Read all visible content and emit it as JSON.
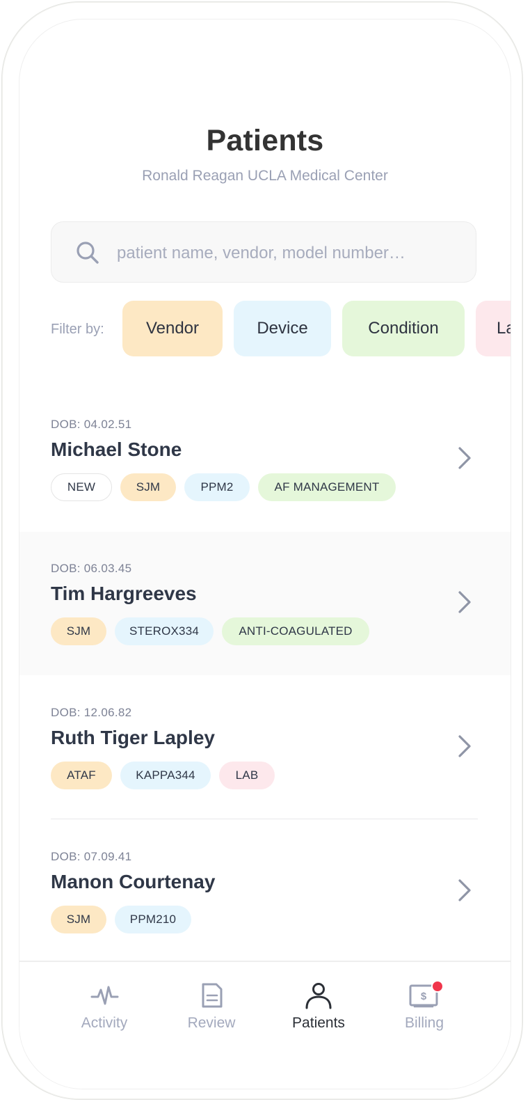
{
  "header": {
    "title": "Patients",
    "subtitle": "Ronald Reagan UCLA Medical Center"
  },
  "search": {
    "placeholder": "patient name, vendor, model number…",
    "value": "",
    "icon": "search-icon"
  },
  "filters": {
    "label": "Filter by:",
    "chips": [
      {
        "label": "Vendor",
        "color": "#fde8c4"
      },
      {
        "label": "Device",
        "color": "#e5f5fd"
      },
      {
        "label": "Condition",
        "color": "#e5f7da"
      },
      {
        "label": "La",
        "color": "#fde8ec"
      }
    ]
  },
  "colors": {
    "vendor": "#fde8c4",
    "device": "#e5f5fd",
    "condition": "#e5f7da",
    "lab": "#fde8ec",
    "new_border": "#e4e4e4",
    "badge": "#f0354b"
  },
  "patients": [
    {
      "dob": "DOB: 04.02.51",
      "name": "Michael Stone",
      "tags": [
        {
          "label": "NEW",
          "kind": "new"
        },
        {
          "label": "SJM",
          "kind": "vendor"
        },
        {
          "label": "PPM2",
          "kind": "device"
        },
        {
          "label": "AF MANAGEMENT",
          "kind": "condition"
        }
      ]
    },
    {
      "dob": "DOB: 06.03.45",
      "name": "Tim Hargreeves",
      "tags": [
        {
          "label": "SJM",
          "kind": "vendor"
        },
        {
          "label": "STEROX334",
          "kind": "device"
        },
        {
          "label": "ANTI-COAGULATED",
          "kind": "condition"
        }
      ]
    },
    {
      "dob": "DOB: 12.06.82",
      "name": "Ruth Tiger Lapley",
      "tags": [
        {
          "label": "ATAF",
          "kind": "vendor"
        },
        {
          "label": "KAPPA344",
          "kind": "device"
        },
        {
          "label": "LAB",
          "kind": "lab"
        }
      ]
    },
    {
      "dob": "DOB: 07.09.41",
      "name": "Manon Courtenay",
      "tags": [
        {
          "label": "SJM",
          "kind": "vendor"
        },
        {
          "label": "PPM210",
          "kind": "device"
        }
      ]
    }
  ],
  "tabs": [
    {
      "label": "Activity",
      "icon": "activity-icon",
      "active": false
    },
    {
      "label": "Review",
      "icon": "document-icon",
      "active": false
    },
    {
      "label": "Patients",
      "icon": "person-icon",
      "active": true
    },
    {
      "label": "Billing",
      "icon": "billing-icon",
      "active": false,
      "badge": true
    }
  ]
}
